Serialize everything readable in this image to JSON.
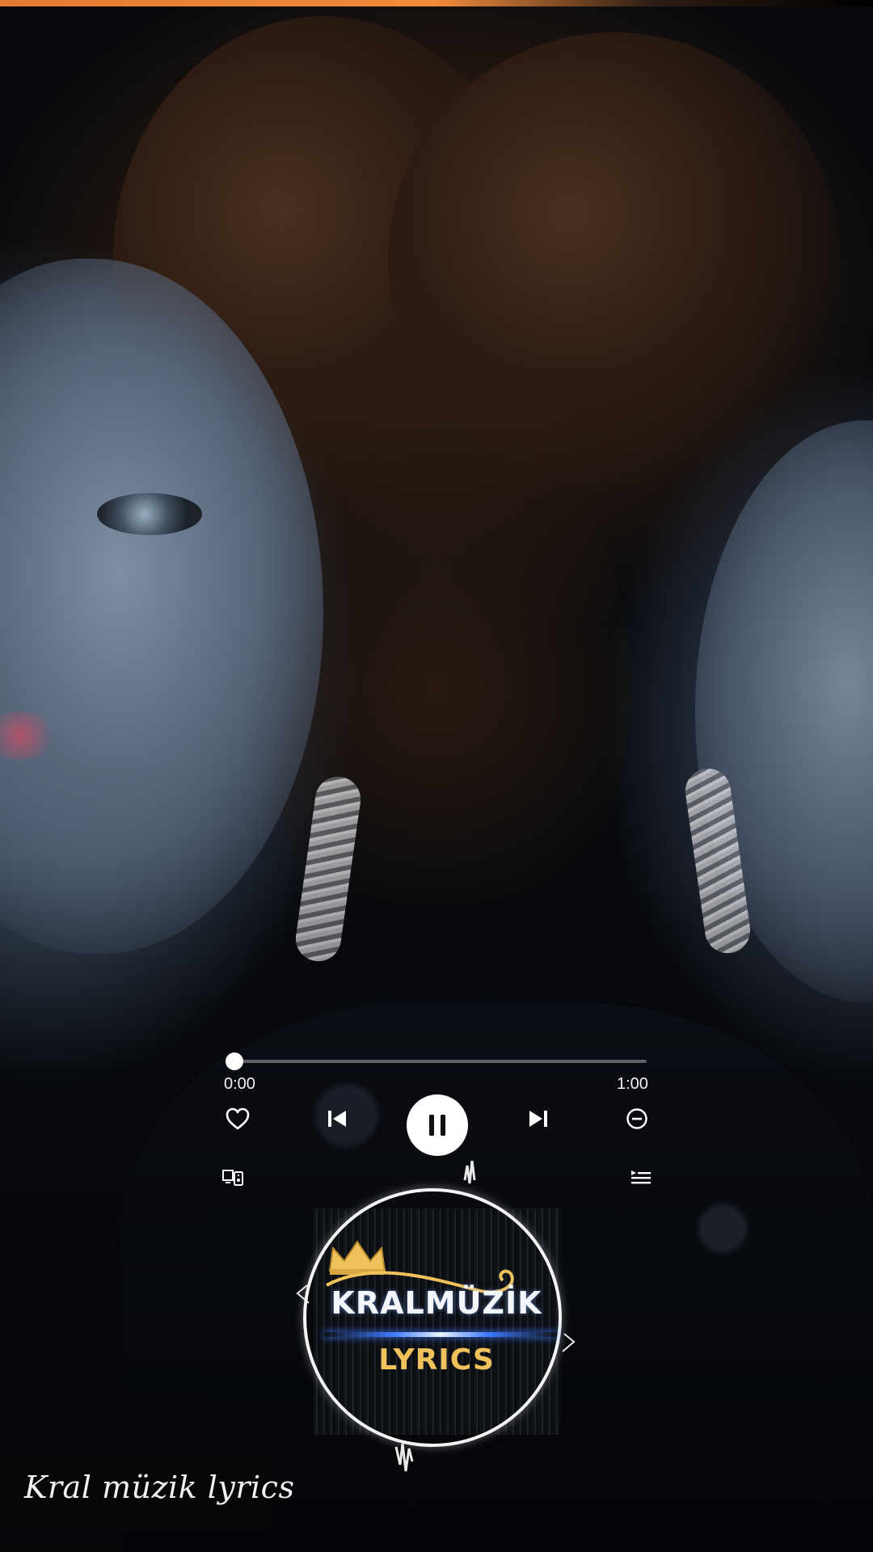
{
  "player": {
    "elapsed": "0:00",
    "duration": "1:00",
    "progress_fraction": 0.0
  },
  "controls": {
    "like_icon": "heart-outline-icon",
    "previous_icon": "skip-previous-icon",
    "playpause_icon": "pause-icon",
    "next_icon": "skip-next-icon",
    "remove_icon": "minus-circle-icon",
    "devices_icon": "connect-devices-icon",
    "queue_icon": "queue-list-icon"
  },
  "logo": {
    "line1": "KRALMÜZİK",
    "line2": "LYRICS"
  },
  "watermark": {
    "text": "Kral müzik lyrics"
  },
  "colors": {
    "accent_bar": "#f08a3c",
    "control_white": "#ffffff",
    "logo_gold": "#f0c25c",
    "logo_blue": "#3d7bff"
  }
}
